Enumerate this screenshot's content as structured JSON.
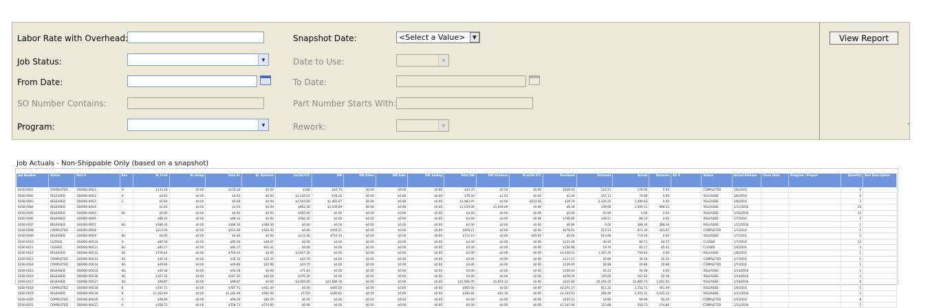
{
  "params": {
    "labor_rate": {
      "label": "Labor Rate with Overhead:",
      "value": ""
    },
    "snapshot_date": {
      "label": "Snapshot Date:",
      "value": "<Select a Value>"
    },
    "job_status": {
      "label": "Job Status:",
      "value": ""
    },
    "date_to_use": {
      "label": "Date to Use:",
      "value": ""
    },
    "from_date": {
      "label": "From Date:",
      "value": ""
    },
    "to_date": {
      "label": "To Date:",
      "value": ""
    },
    "so_number": {
      "label": "SO Number Contains:",
      "value": ""
    },
    "part_number": {
      "label": "Part Number Starts With:",
      "value": ""
    },
    "program": {
      "label": "Program:",
      "value": ""
    },
    "rework": {
      "label": "Rework:",
      "value": ""
    }
  },
  "view_report_label": "View Report",
  "report": {
    "title": "Job Actuals - Non-Shippable Only (based on a snapshot)",
    "columns": [
      "Job Number",
      "Status",
      "Part #",
      "Rev",
      "SL Prod",
      "SL Setup",
      "Total SL",
      "SL Variance",
      "Lw/OH ETC",
      "DM",
      "DM Other",
      "DM Subc",
      "DM Tooling",
      "Total DM",
      "DM Variance",
      "M w/OH ETC",
      "Overhead",
      "Estimate",
      "Actual",
      "Variance",
      "SO #",
      "Status",
      "Actual Release",
      "Close Date",
      "Program / Project",
      "Quantity",
      "Part Description"
    ],
    "rows": [
      [
        "S2S0-0001",
        "COMPLETED",
        "100000-00G1",
        "X-",
        "$133.18",
        "$0.00",
        "$133.18",
        "$0.00",
        "$108",
        "$43.70",
        "$0.00",
        "$0.00",
        "$0.00",
        "$43.70",
        "$0.04",
        "$0.00",
        "$528.45",
        "214.21",
        "178.55",
        "0.00",
        "",
        "COMPLETED",
        "1/8/2016",
        "",
        "",
        "5",
        ""
      ],
      [
        "S2S0-0002",
        "RELEASED",
        "100000-00G2",
        "X-",
        "$0.63",
        "$0.00",
        "$0.63",
        "$0.00",
        "$1,120.02",
        "$78.20",
        "$0.00",
        "$0.00",
        "$0.00",
        "$78.20",
        "$1.03",
        "$0.00",
        "$2.49",
        "357.11",
        "79.80",
        "0.00",
        "",
        "RELEASED",
        "1/8/2016",
        "",
        "",
        "5",
        ""
      ],
      [
        "S2S0-0003",
        "RELEASED",
        "100000-00G3",
        "C",
        "$5.69",
        "$0.00",
        "$5.69",
        "$0.00",
        "$1,643.00",
        "$1,483.97",
        "$0.00",
        "$0.00",
        "$0.00",
        "$1,483.97",
        "$0.00",
        "$214.06",
        "$29.79",
        "2,326.25",
        "1,489.63",
        "0.00",
        "",
        "RELEASED",
        "1/8/2016",
        "",
        "",
        "7",
        ""
      ],
      [
        "S2S0-0004",
        "RELEASED",
        "100000-00G4",
        "-",
        "$1.03",
        "$0.00",
        "$1.03",
        "$0.00",
        "$652.30",
        "$1,039.09",
        "$0.00",
        "$0.00",
        "$0.00",
        "$1,039.09",
        "$1,039.09",
        "$0.00",
        "$6.39",
        "139.05",
        "1,040.11",
        "908.51",
        "",
        "RELEASED",
        "1/11/2016",
        "",
        "",
        "10",
        ""
      ],
      [
        "S2S0-0005",
        "RELEASED",
        "100000-00G5",
        "KG",
        "$0.00",
        "$0.00",
        "$0.00",
        "$0.00",
        "$585.00",
        "$0.00",
        "$0.00",
        "$0.00",
        "$0.00",
        "$0.00",
        "$0.00",
        "$0.00",
        "$0.00",
        "93.59",
        "0.00",
        "0.00",
        "",
        "RELEASED",
        "1/15/2016",
        "",
        "",
        "33",
        ""
      ],
      [
        "S2S0-0006",
        "RELEASED",
        "100000-00G6",
        "-",
        "$88.33",
        "$0.00",
        "$88.33",
        "$0.00",
        "$583.20",
        "$0.00",
        "$0.00",
        "$0.00",
        "$0.00",
        "$0.00",
        "$0.00",
        "$0.00",
        "$746.85",
        "108.11",
        "88.33",
        "0.00",
        "",
        "RELEASED",
        "1/7/2016",
        "",
        "",
        "2",
        ""
      ],
      [
        "S2S0-0007",
        "RELEASED",
        "100000-00G7",
        "KG",
        "$388.30",
        "$0.00",
        "$388.30",
        "$388.30",
        "$0.00",
        "$0.00",
        "$0.00",
        "$0.00",
        "$0.00",
        "$0.00",
        "$0.00",
        "$0.00",
        "$6.89",
        "0.00",
        "388.30",
        "388.30",
        "",
        "RELEASED",
        "1/11/2016",
        "",
        "",
        "1",
        ""
      ],
      [
        "S2S0-0008",
        "COMPLETED",
        "100000-00G8",
        "-",
        "$213.09",
        "$0.00",
        "$213.09",
        "$183.00",
        "$0.00",
        "$459.21",
        "$0.00",
        "$0.00",
        "$0.00",
        "$459.21",
        "$0.00",
        "$0.00",
        "$678.01",
        "512.23",
        "673.30",
        "181.07",
        "",
        "COMPLETED",
        "1/7/2016",
        "",
        "",
        "1",
        ""
      ],
      [
        "S2S0-0009",
        "RELEASED",
        "100000-00G9",
        "KG",
        "$0.00",
        "$0.00",
        "$0.00",
        "$0.00",
        "$111.00",
        "$710.10",
        "$0.00",
        "$0.00",
        "$0.00",
        "$710.10",
        "$0.00",
        "$93.00",
        "$0.00",
        "813.84",
        "719.10",
        "0.00",
        "",
        "RELEASED",
        "1/7/2016",
        "",
        "",
        "1",
        ""
      ],
      [
        "S2S0-0010",
        "CLOSED",
        "100000-00G10",
        "X-",
        "$85.56",
        "$0.00",
        "$85.56",
        "$48.67",
        "$0.00",
        "$4.00",
        "$0.00",
        "$0.00",
        "$0.00",
        "$4.00",
        "$0.00",
        "$0.00",
        "$131.46",
        "40.44",
        "89.71",
        "40.27",
        "",
        "CLOSED",
        "1/7/2016",
        "",
        "",
        "12",
        ""
      ],
      [
        "S2S0-0011",
        "CLOSED",
        "100000-00G11",
        "KG",
        "$85.17",
        "$0.00",
        "$85.17",
        "$65.41",
        "$0.00",
        "$0.00",
        "$0.00",
        "$0.00",
        "$0.00",
        "$0.00",
        "$0.00",
        "$0.00",
        "$130.80",
        "10.76",
        "85.17",
        "65.41",
        "",
        "CLOSED",
        "1/4/2016",
        "",
        "",
        "1",
        ""
      ],
      [
        "S2S0-0012",
        "RELEASED",
        "100000-00G12",
        "KG",
        "$759.44",
        "$0.00",
        "$759.44",
        "$0.00",
        "$3,827.20",
        "$0.00",
        "$0.00",
        "$0.00",
        "$0.00",
        "$0.00",
        "$0.00",
        "$0.00",
        "$1,438.51",
        "1,307.20",
        "759.44",
        "0.00",
        "",
        "RELEASED",
        "1/8/2016",
        "",
        "",
        "1",
        ""
      ],
      [
        "S2S0-0013",
        "COMPLETED",
        "100000-00G13",
        "KG",
        "$36.15",
        "$0.00",
        "$36.15",
        "$15.35",
        "$24.70",
        "$0.00",
        "$0.00",
        "$0.00",
        "$0.00",
        "$0.00",
        "$0.00",
        "$0.00",
        "$117.11",
        "20.80",
        "36.15",
        "15.35",
        "",
        "COMPLETED",
        "1/7/2016",
        "",
        "",
        "1",
        ""
      ],
      [
        "S2S0-0014",
        "COMPLETED",
        "100000-00G14",
        "KG",
        "$49.86",
        "$0.00",
        "$49.86",
        "$20.98",
        "$24.70",
        "$0.00",
        "$0.00",
        "$0.00",
        "$0.00",
        "$0.00",
        "$0.00",
        "$0.00",
        "$139.49",
        "28.88",
        "49.86",
        "20.98",
        "",
        "COMPLETED",
        "1/7/2016",
        "",
        "",
        "1",
        ""
      ],
      [
        "S2S0-0015",
        "RELEASED",
        "100000-00G15",
        "KG",
        "$40.38",
        "$0.00",
        "$40.38",
        "$0.00",
        "$71.83",
        "$0.00",
        "$0.00",
        "$0.00",
        "$0.00",
        "$0.00",
        "$0.00",
        "$0.00",
        "$130.44",
        "64.23",
        "40.38",
        "0.00",
        "",
        "RELEASED",
        "1/14/2016",
        "",
        "",
        "1",
        ""
      ],
      [
        "S2S0-0016",
        "RELEASED",
        "100000-00G16",
        "KG",
        "$167.32",
        "$0.00",
        "$167.32",
        "$42.28",
        "$370.20",
        "$0.00",
        "$0.00",
        "$0.00",
        "$0.00",
        "$0.00",
        "$0.00",
        "$0.00",
        "$476.59",
        "125.04",
        "167.32",
        "42.28",
        "",
        "RELEASED",
        "1/14/2016",
        "",
        "",
        "1",
        ""
      ],
      [
        "S2S0-0017",
        "RELEASED",
        "100000-00G17",
        "KG",
        "$98.87",
        "$0.00",
        "$98.87",
        "$0.00",
        "$3,020.00",
        "$21,586.76",
        "$0.00",
        "$0.00",
        "$0.00",
        "$21,586.76",
        "$1,816.14",
        "$0.00",
        "$231.80",
        "20,264.20",
        "21,685.73",
        "1,621.54",
        "",
        "RELEASED",
        "1/18/2016",
        "",
        "",
        "6",
        ""
      ],
      [
        "S2S0-0018",
        "COMPLETED",
        "100000-00G18",
        "B",
        "$787.71",
        "$0.00",
        "$787.71",
        "$441.49",
        "$0.00",
        "$465.00",
        "$0.00",
        "$0.00",
        "$0.00",
        "$465.00",
        "$0.00",
        "$0.00",
        "$2,071.27",
        "811.22",
        "1,252.71",
        "441.49",
        "",
        "RELEASED",
        "1/8/2016",
        "",
        "",
        "1",
        ""
      ],
      [
        "S2S0-0019",
        "RELEASED",
        "100000-00G19",
        "B",
        "$1,162.49",
        "$0.00",
        "$1,162.49",
        "$561.00",
        "$1720",
        "$180.82",
        "$0.00",
        "$0.00",
        "$0.00",
        "$180.82",
        "$81.18",
        "$0.00",
        "$3,103.51",
        "358.20",
        "1,343.31",
        "1,025.10",
        "",
        "RELEASED",
        "1/11/2016",
        "",
        "",
        "1",
        ""
      ],
      [
        "S2S0-0020",
        "COMPLETED",
        "100000-00G20",
        "A",
        "$96.09",
        "$0.00",
        "$96.09",
        "$85.29",
        "$0.00",
        "$0.00",
        "$0.00",
        "$0.00",
        "$0.00",
        "$0.00",
        "$0.00",
        "$0.00",
        "$255.51",
        "10.80",
        "96.09",
        "85.29",
        "",
        "COMPLETED",
        "1/5/2016",
        "",
        "",
        "8",
        ""
      ],
      [
        "S2S0-0021",
        "COMPLETED",
        "100000-00G21",
        "A",
        "$358.73",
        "$0.00",
        "$358.73",
        "$274.85",
        "$0.00",
        "$0.00",
        "$0.00",
        "$0.00",
        "$0.00",
        "$0.00",
        "$0.00",
        "$0.00",
        "$1,101.94",
        "115.88",
        "358.73",
        "274.85",
        "",
        "COMPLETED",
        "1/11/2016",
        "",
        "",
        "1",
        ""
      ]
    ]
  },
  "colors": {
    "panel": "#ece9d8",
    "header": "#6f95de",
    "input_border": "#7f9db9"
  }
}
